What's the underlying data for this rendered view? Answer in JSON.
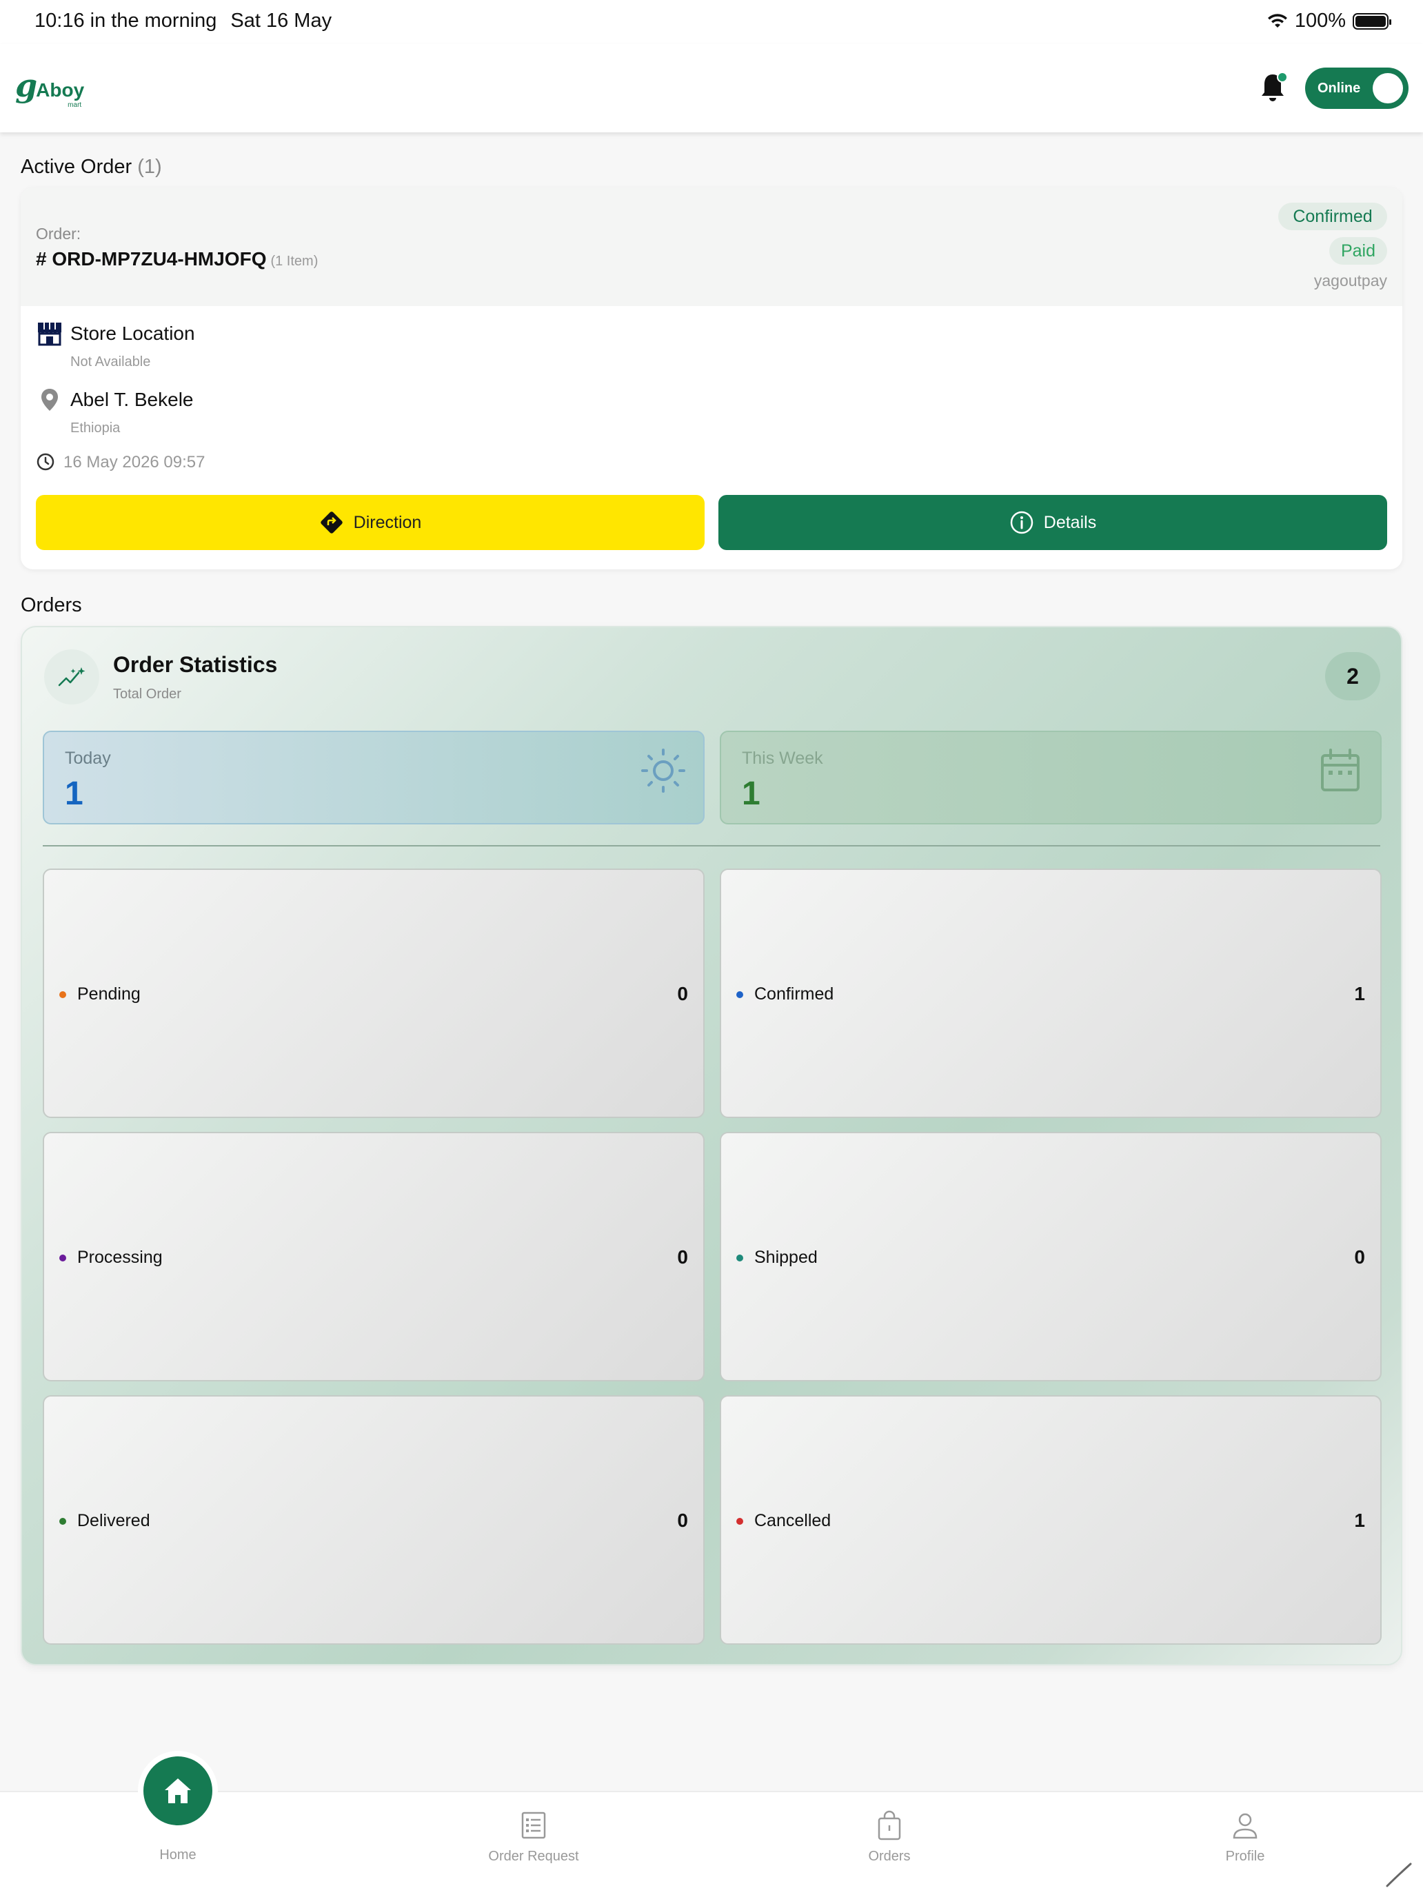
{
  "status_bar": {
    "time": "10:16 in the morning",
    "date": "Sat 16 May",
    "battery": "100%"
  },
  "header": {
    "logo_text": "Aboy",
    "logo_sub": "mart",
    "online_label": "Online",
    "online_state": true,
    "icons": [
      "bell-icon"
    ]
  },
  "active_order": {
    "section_title": "Active Order",
    "count": "(1)",
    "order_label": "Order:",
    "order_number": "# ORD-MP7ZU4-HMJOFQ",
    "items": "(1 Item)",
    "badge_status": "Confirmed",
    "badge_payment": "Paid",
    "payment_method": "yagoutpay",
    "store_title": "Store Location",
    "store_sub": "Not Available",
    "customer_name": "Abel T. Bekele",
    "customer_country": "Ethiopia",
    "datetime": "16 May 2026  09:57",
    "direction_button": "Direction",
    "details_button": "Details"
  },
  "orders": {
    "section_title": "Orders",
    "stats_title": "Order Statistics",
    "stats_sub": "Total Order",
    "total": "2",
    "today_label": "Today",
    "today_value": "1",
    "week_label": "This Week",
    "week_value": "1",
    "statuses": [
      {
        "label": "Pending",
        "count": "0",
        "color": "#e8731a"
      },
      {
        "label": "Confirmed",
        "count": "1",
        "color": "#1e63c8"
      },
      {
        "label": "Processing",
        "count": "0",
        "color": "#6a1b9a"
      },
      {
        "label": "Shipped",
        "count": "0",
        "color": "#1e8a7a"
      },
      {
        "label": "Delivered",
        "count": "0",
        "color": "#2e7d32"
      },
      {
        "label": "Cancelled",
        "count": "1",
        "color": "#d32f2f"
      }
    ]
  },
  "bottom_nav": {
    "home": "Home",
    "order_request": "Order Request",
    "orders": "Orders",
    "profile": "Profile"
  },
  "colors": {
    "brand": "#157a52",
    "direction_yellow": "#ffe600"
  }
}
